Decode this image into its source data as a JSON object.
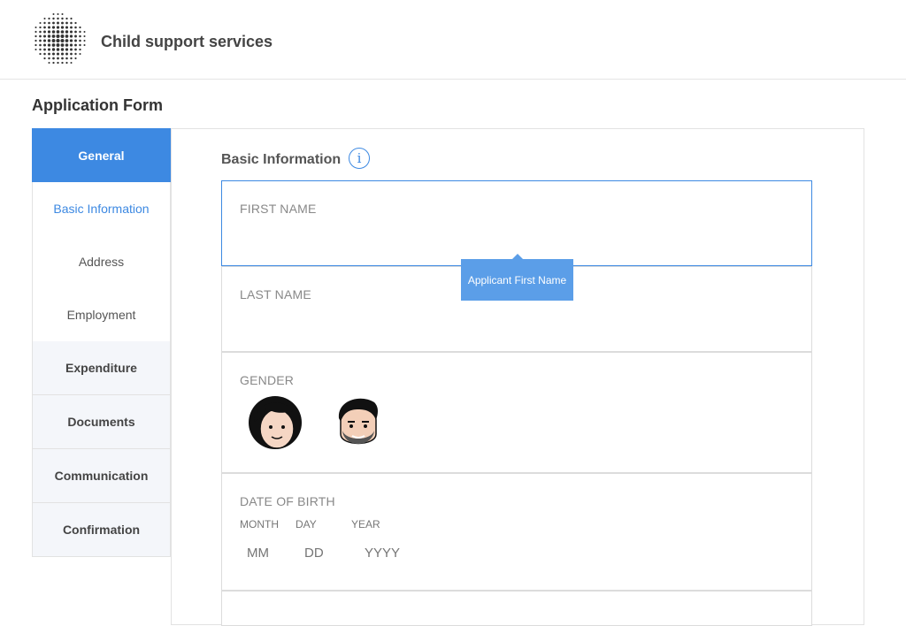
{
  "header": {
    "app_title": "Child support services",
    "logo_icon": "dotted-sphere-logo-icon"
  },
  "page": {
    "title": "Application Form"
  },
  "sidebar": {
    "items": [
      {
        "label": "General"
      },
      {
        "label": "Basic Information"
      },
      {
        "label": "Address"
      },
      {
        "label": "Employment"
      },
      {
        "label": "Expenditure"
      },
      {
        "label": "Documents"
      },
      {
        "label": "Communication"
      },
      {
        "label": "Confirmation"
      }
    ]
  },
  "form": {
    "section_title": "Basic Information",
    "info_icon": "i",
    "first_name": {
      "label": "FIRST NAME",
      "value": ""
    },
    "tooltip": "Applicant First Name",
    "last_name": {
      "label": "LAST NAME",
      "value": ""
    },
    "gender": {
      "label": "GENDER",
      "options": [
        "female-avatar-icon",
        "male-avatar-icon"
      ]
    },
    "dob": {
      "label": "DATE OF BIRTH",
      "month_label": "MONTH",
      "day_label": "DAY",
      "year_label": "YEAR",
      "month_placeholder": "MM",
      "day_placeholder": "DD",
      "year_placeholder": "YYYY"
    }
  },
  "colors": {
    "accent": "#3d89e2",
    "tooltip": "#5b9ee8",
    "section_bg": "#f4f6fa"
  }
}
